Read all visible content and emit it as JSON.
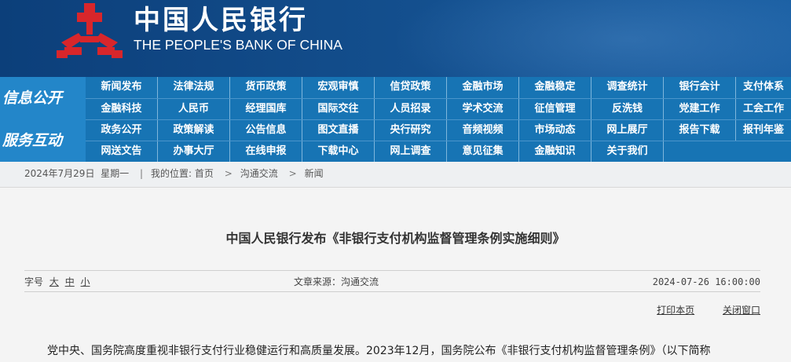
{
  "header": {
    "bank_name_cn": "中国人民银行",
    "bank_name_en": "THE PEOPLE'S BANK OF CHINA",
    "logo_icon": "pboc-emblem-icon",
    "colors": {
      "header_bg": "#0c3f7a",
      "logo_red": "#d8262b",
      "nav_bg": "#1774b4"
    }
  },
  "nav": {
    "section1_label": "信息公开",
    "section2_label": "服务互动",
    "row1": [
      "新闻发布",
      "法律法规",
      "货币政策",
      "宏观审慎",
      "信贷政策",
      "金融市场",
      "金融稳定",
      "调查统计",
      "银行会计",
      "支付体系"
    ],
    "row2": [
      "金融科技",
      "人民币",
      "经理国库",
      "国际交往",
      "人员招录",
      "学术交流",
      "征信管理",
      "反洗钱",
      "党建工作",
      "工会工作"
    ],
    "row3": [
      "政务公开",
      "政策解读",
      "公告信息",
      "图文直播",
      "央行研究",
      "音频视频",
      "市场动态",
      "网上展厅",
      "报告下载",
      "报刊年鉴"
    ],
    "row4": [
      "网送文告",
      "办事大厅",
      "在线申报",
      "下载中心",
      "网上调查",
      "意见征集",
      "金融知识",
      "关于我们"
    ]
  },
  "breadcrumb": {
    "date": "2024年7月29日",
    "weekday": "星期一",
    "prefix": "我的位置:",
    "home": "首页",
    "level1": "沟通交流",
    "level2": "新闻",
    "separator": "|",
    "chevron": ">"
  },
  "article": {
    "title": "中国人民银行发布《非银行支付机构监督管理条例实施细则》",
    "font_size_label": "字号",
    "font_large": "大",
    "font_medium": "中",
    "font_small": "小",
    "source": "文章来源：沟通交流",
    "datetime": "2024-07-26 16:00:00",
    "print_label": "打印本页",
    "close_label": "关闭窗口",
    "first_line": "党中央、国务院高度重视非银行支付行业稳健运行和高质量发展。2023年12月，国务院公布《非银行支付机构监督管理条例》（以下简称"
  }
}
